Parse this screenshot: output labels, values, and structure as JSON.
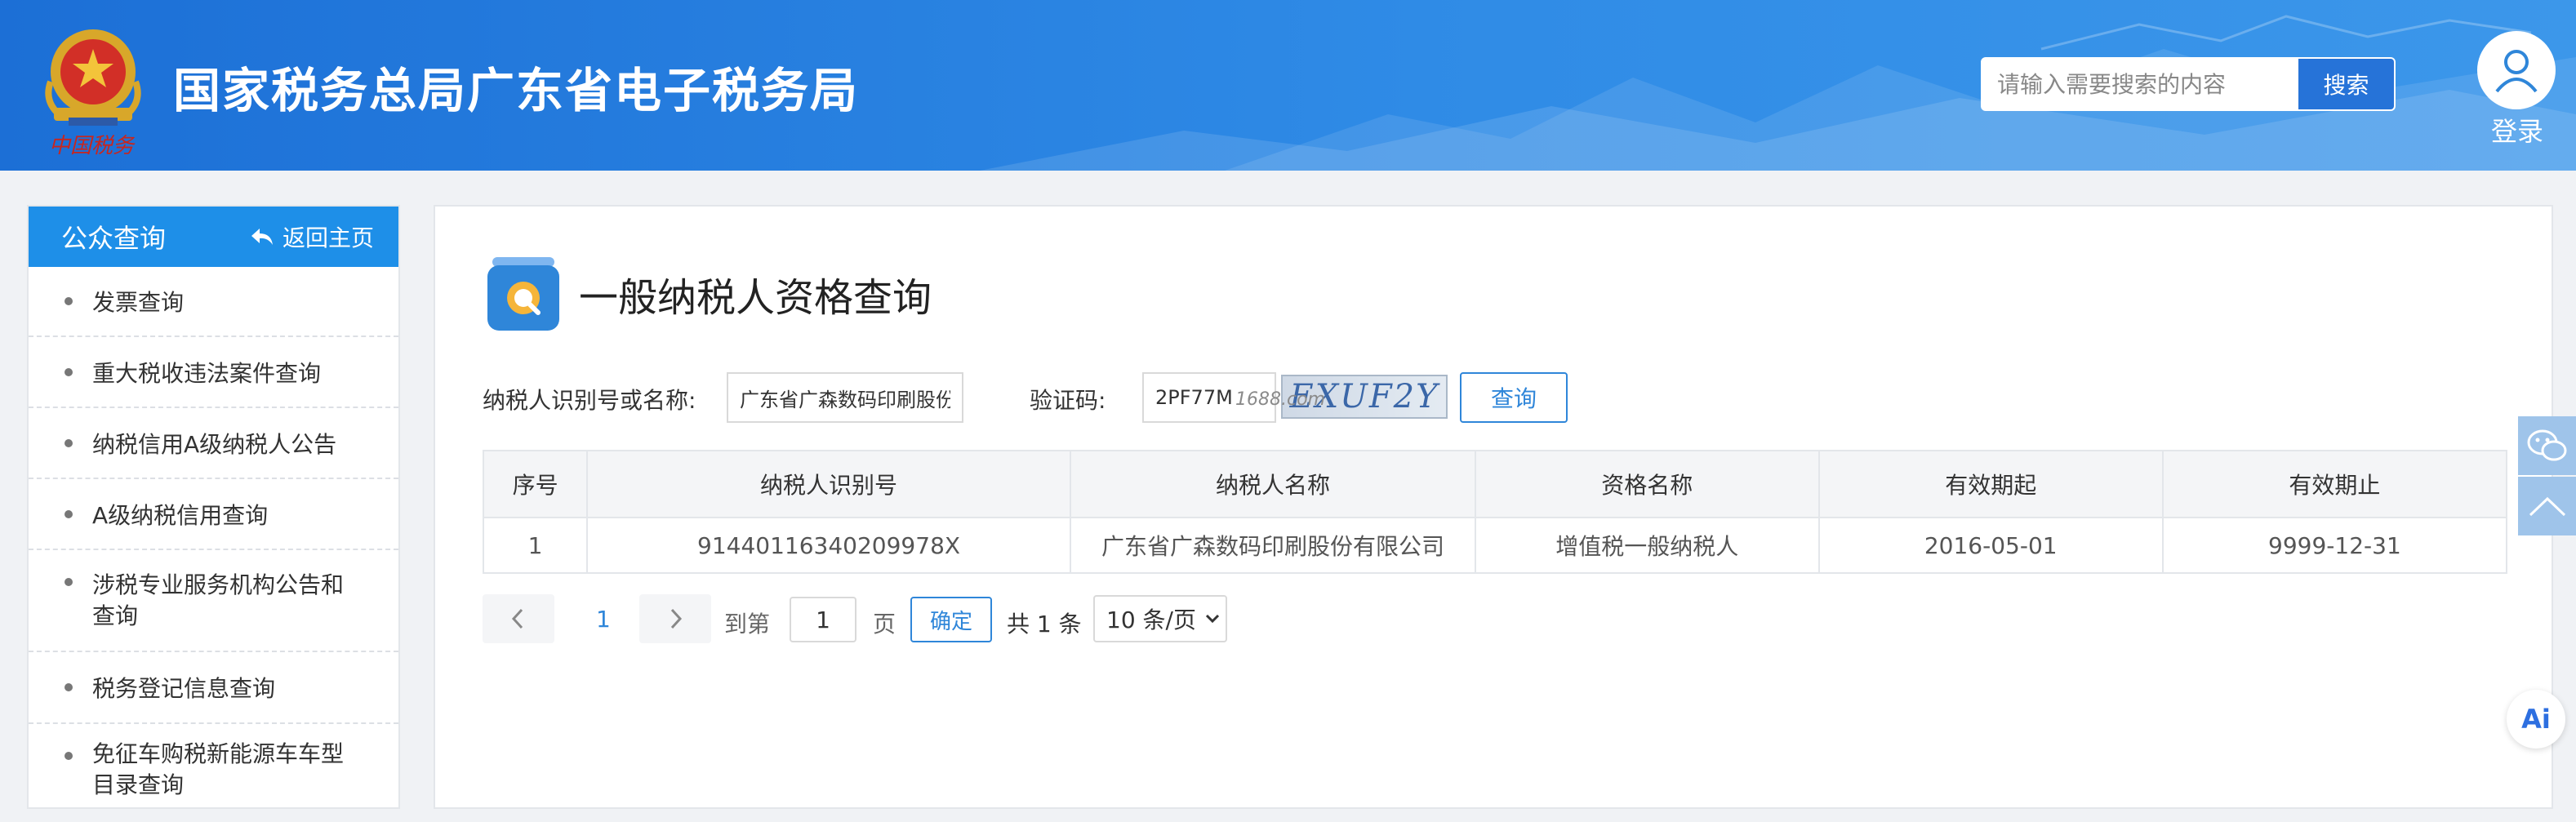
{
  "header": {
    "title": "国家税务总局广东省电子税务局",
    "emblem_caption": "中国税务",
    "search_placeholder": "请输入需要搜索的内容",
    "search_button": "搜索",
    "login_label": "登录"
  },
  "sidebar": {
    "title": "公众查询",
    "back_home": "返回主页",
    "items": [
      {
        "label": "发票查询"
      },
      {
        "label": "重大税收违法案件查询"
      },
      {
        "label": "纳税信用A级纳税人公告"
      },
      {
        "label": "A级纳税信用查询"
      },
      {
        "label": "涉税专业服务机构公告和查询"
      },
      {
        "label": "税务登记信息查询"
      },
      {
        "label": "免征车购税新能源车车型目录查询"
      }
    ]
  },
  "main": {
    "page_title": "一般纳税人资格查询",
    "form": {
      "taxpayer_label": "纳税人识别号或名称:",
      "taxpayer_value": "广东省广森数码印刷股份",
      "captcha_label": "验证码:",
      "captcha_value": "2PF77M",
      "captcha_image_text": "EXUF2Y",
      "captcha_watermark": "1688.com",
      "query_button": "查询"
    },
    "table": {
      "columns": [
        "序号",
        "纳税人识别号",
        "纳税人名称",
        "资格名称",
        "有效期起",
        "有效期止"
      ],
      "rows": [
        [
          "1",
          "91440116340209978X",
          "广东省广森数码印刷股份有限公司",
          "增值税一般纳税人",
          "2016-05-01",
          "9999-12-31"
        ]
      ]
    },
    "pagination": {
      "current_page": "1",
      "goto_prefix": "到第",
      "goto_value": "1",
      "goto_suffix": "页",
      "confirm": "确定",
      "total": "共 1 条",
      "page_size": "10 条/页"
    }
  },
  "floating": {
    "ai_label": "Ai"
  },
  "colors": {
    "header_blue": "#2f8be6",
    "sidebar_head": "#1e8fe8",
    "link_blue": "#2f86d9"
  }
}
